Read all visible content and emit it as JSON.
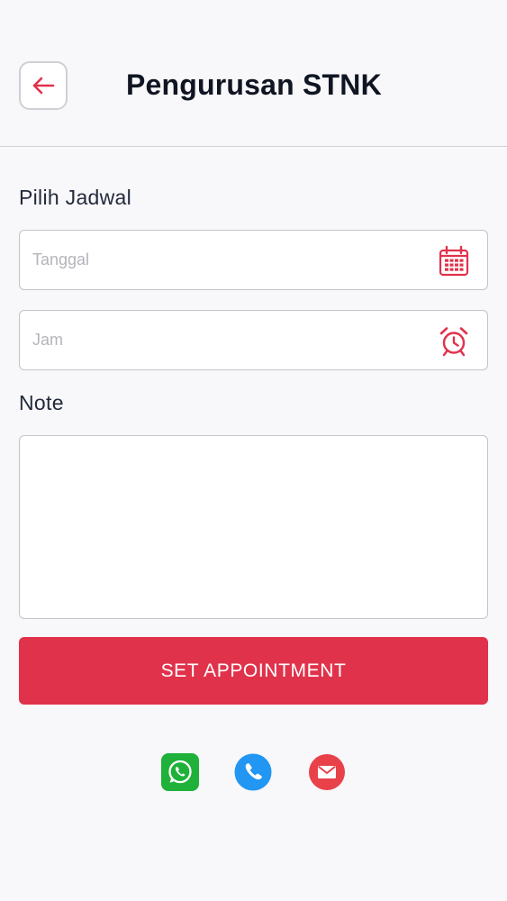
{
  "header": {
    "title": "Pengurusan STNK"
  },
  "schedule": {
    "label": "Pilih Jadwal",
    "date_placeholder": "Tanggal",
    "time_placeholder": "Jam"
  },
  "note": {
    "label": "Note",
    "value": ""
  },
  "actions": {
    "submit_label": "SET APPOINTMENT"
  },
  "contacts": [
    "whatsapp-icon",
    "phone-icon",
    "email-icon"
  ],
  "colors": {
    "accent": "#e1324b",
    "whatsapp": "#1fb13a",
    "phone": "#2196f3",
    "email": "#e8414a"
  }
}
